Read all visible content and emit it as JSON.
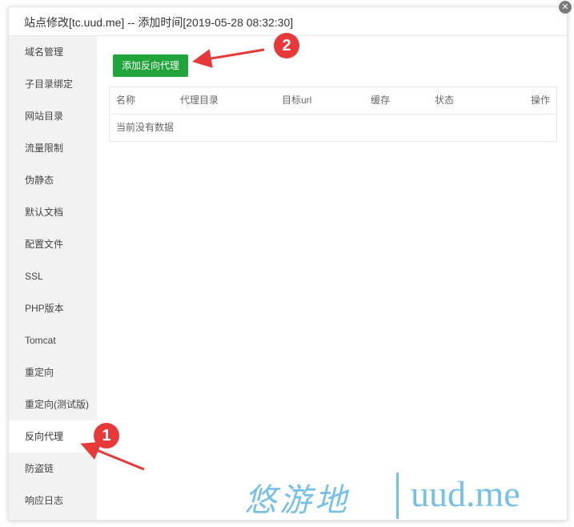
{
  "window": {
    "title": "站点修改[tc.uud.me] -- 添加时间[2019-05-28 08:32:30]",
    "close_icon": "close-icon"
  },
  "sidebar": {
    "items": [
      {
        "label": "域名管理"
      },
      {
        "label": "子目录绑定"
      },
      {
        "label": "网站目录"
      },
      {
        "label": "流量限制"
      },
      {
        "label": "伪静态"
      },
      {
        "label": "默认文档"
      },
      {
        "label": "配置文件"
      },
      {
        "label": "SSL"
      },
      {
        "label": "PHP版本"
      },
      {
        "label": "Tomcat"
      },
      {
        "label": "重定向"
      },
      {
        "label": "重定向(测试版)"
      },
      {
        "label": "反向代理",
        "active": true
      },
      {
        "label": "防盗链"
      },
      {
        "label": "响应日志"
      }
    ]
  },
  "main": {
    "add_button": "添加反向代理",
    "table": {
      "headers": [
        "名称",
        "代理目录",
        "目标url",
        "缓存",
        "状态",
        "操作"
      ],
      "empty_text": "当前没有数据"
    }
  },
  "annotations": {
    "badge_1": "1",
    "badge_2": "2",
    "color": "#e63a3a"
  },
  "watermark": {
    "chinese": "悠游地",
    "domain": "uud.me"
  },
  "colors": {
    "accent_green": "#20a53a",
    "sidebar_bg": "#f2f2f2",
    "watermark": "#5fb6e3"
  }
}
